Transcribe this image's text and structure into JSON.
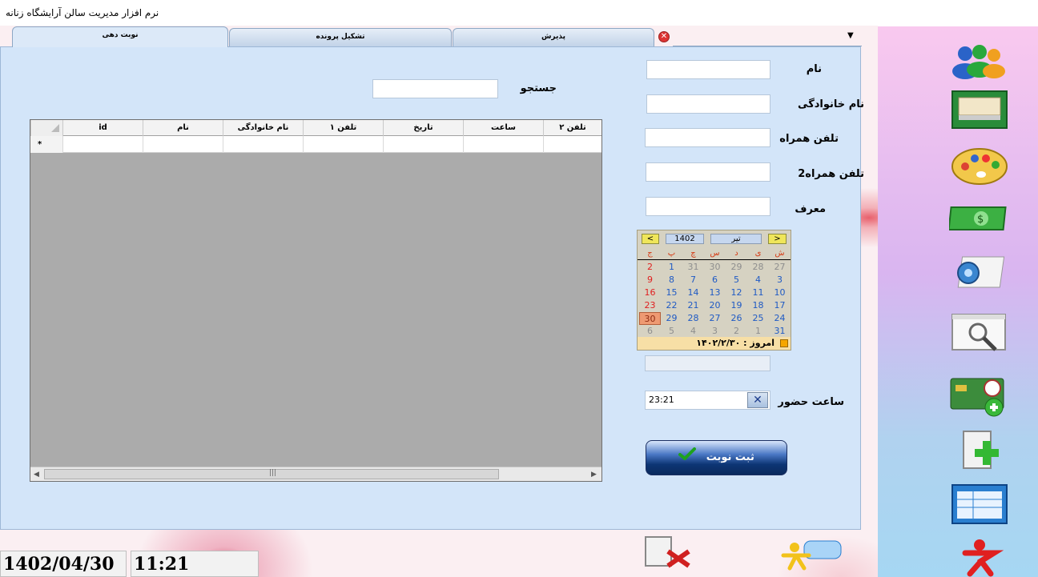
{
  "window": {
    "title": "نرم افزار مدیریت سالن آرایشگاه زنانه"
  },
  "tabs": [
    {
      "label": "نوبت دهی",
      "active": true
    },
    {
      "label": "تشکیل پرونده",
      "active": false
    },
    {
      "label": "پذیرش",
      "active": false
    }
  ],
  "form": {
    "name_label": "نام",
    "family_label": "نام خانوادگی",
    "mobile_label": "تلفن همراه",
    "mobile2_label": "تلفن همراه2",
    "referrer_label": "معرف",
    "search_label": "جستجو",
    "arrival_time_label": "ساعت حضور",
    "arrival_time_value": "23:21",
    "submit_label": "ثبت نوبت"
  },
  "grid": {
    "columns": [
      "id",
      "نام",
      "نام خانوادگی",
      "تلفن ۱",
      "تاریخ",
      "ساعت",
      "تلفن ۲"
    ],
    "new_row_marker": "*"
  },
  "calendar": {
    "prev_label": "<",
    "next_label": ">",
    "year": "1402",
    "month": "تیر",
    "weekdays": [
      "ش",
      "ی",
      "د",
      "س",
      "چ",
      "پ",
      "ج"
    ],
    "weeks": [
      [
        "27",
        "28",
        "29",
        "30",
        "31",
        "1",
        "2"
      ],
      [
        "3",
        "4",
        "5",
        "6",
        "7",
        "8",
        "9"
      ],
      [
        "10",
        "11",
        "12",
        "13",
        "14",
        "15",
        "16"
      ],
      [
        "17",
        "18",
        "19",
        "20",
        "21",
        "22",
        "23"
      ],
      [
        "24",
        "25",
        "26",
        "27",
        "28",
        "29",
        "30"
      ],
      [
        "31",
        "1",
        "2",
        "3",
        "4",
        "5",
        "6"
      ]
    ],
    "selected_day": "30",
    "today_text": "امروز : ۱۴۰۲/۲/۳۰"
  },
  "statusbar": {
    "date": "1402/04/30",
    "time": "11:21"
  },
  "sidebar": {
    "icons": [
      "customers-icon",
      "files-drawer-icon",
      "palette-icon",
      "money-icon",
      "settings-icon",
      "search-window-icon",
      "add-card-icon",
      "add-document-icon",
      "schedule-table-icon",
      "exit-icon"
    ]
  },
  "colors": {
    "panel": "#d3e5f9",
    "accent": "#0d3574",
    "grid_bg": "#ababab",
    "selected_day": "#ee9a72"
  }
}
